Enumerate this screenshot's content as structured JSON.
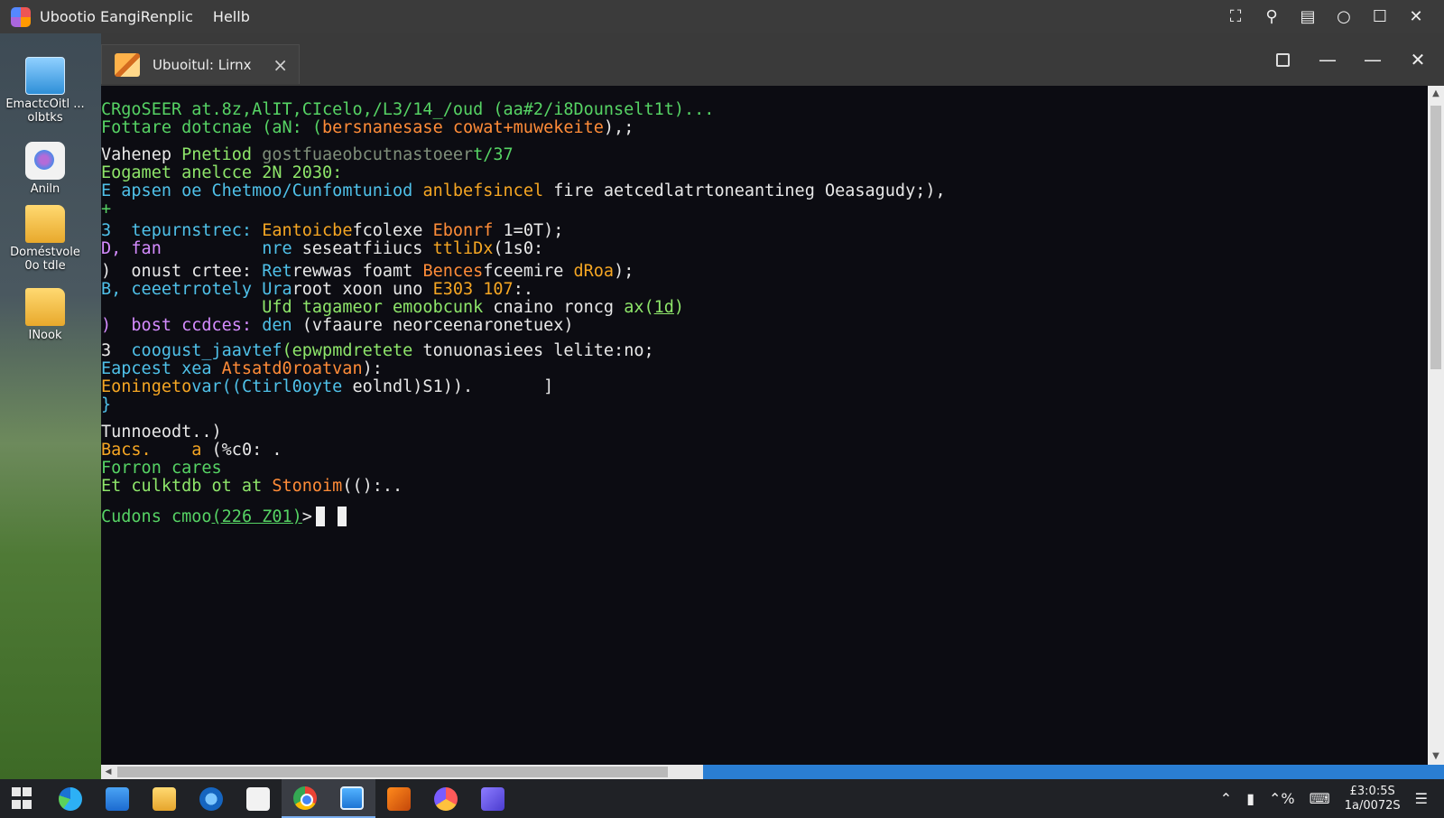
{
  "topbar": {
    "title_1": "Ubootio EangiRenplic",
    "title_2": "Hellb"
  },
  "desktop": {
    "icons": [
      {
        "label": "EmactcOitl ... olbtks",
        "icon": "drive-icon"
      },
      {
        "label": "Aniln",
        "icon": "app-icon"
      },
      {
        "label": "Doméstvole 0o tdle",
        "icon": "folder-icon"
      },
      {
        "label": "INook",
        "icon": "folder-icon"
      }
    ]
  },
  "window": {
    "tab_title": "Ubuoitul: Lirnx",
    "tab_close": "×"
  },
  "terminal": {
    "l1": "CRgoSEER at.8z,AlIT,CIcelo,/L3/14_/oud (aa#2/i8Dounselt1t)...",
    "l2a": "Fottare dotcnae (aN: (",
    "l2b": "bersnanesase cowat+muwekeite",
    "l2c": "),;",
    "l3a": "Vahenep ",
    "l3b": "Pnetiod ",
    "l3c": "gostfuaeobcutnastoeer",
    "l3d": "t/37",
    "l4": "Eogamet anelcce 2N 2030:",
    "l5a": "E apsen oe ",
    "l5b": "Chetmoo/Cunfomtuniod ",
    "l5c": "anlbefsincel ",
    "l5d": "fire aetce",
    "l5e": "dlatrtoneantineg Oeasagudy;),",
    "l6": "+",
    "l7a": "3  tepurnstrec: ",
    "l7b": "Eantoicbe",
    "l7c": "fcolexe ",
    "l7d": "Ebonrf",
    "l7e": " 1=0T);",
    "l8a": "D, fan          ",
    "l8b": "nre ",
    "l8c": "seseatfiiucs ",
    "l8d": "ttliDx",
    "l8e": "(1s0:",
    "l9a": ")  onust crtee: ",
    "l9b": "Ret",
    "l9c": "rewwas foamt ",
    "l9d": "Bences",
    "l9e": "fceemire ",
    "l9f": "dRoa",
    "l9g": ");",
    "l10a": "B, ceeetrrotely ",
    "l10b": "Ura",
    "l10c": "root xoon uno ",
    "l10d": "E303 107",
    "l10e": ":.",
    "l11a": "                ",
    "l11b": "Ufd tagameor emoobcunk ",
    "l11c": "cnaino roncg ",
    "l11d": "ax(",
    "l11e": "1d",
    "l11f": ")",
    "l12a": ")  bost ccdces: ",
    "l12b": "den ",
    "l12c": "(vfaaure neorceenaronetuex)",
    "l13a": "3  ",
    "l13b": "coogust_jaavtef",
    "l13c": "(epwpmdretete ",
    "l13d": "tonuonasiees lelite:no;",
    "l14a": "Eapcest xea ",
    "l14b": "Atsatd0roatvan",
    "l14c": "):",
    "l15a": "Eoningeto",
    "l15b": "var((Ctirl0oyte ",
    "l15c": "eolndl)S1)).       ]",
    "l16": "}",
    "l17": "Tunnoeodt..)",
    "l18a": "Bacs.    a ",
    "l18b": "(%c0: .",
    "l19": "Forron cares",
    "l20a": "Et culktdb ot at ",
    "l20b": "Stonoim",
    "l20c": "(():..",
    "prompt_a": "Cudons cmoo",
    "prompt_b": "(226 Z01)",
    "prompt_c": ">"
  },
  "clock": {
    "time": "£3:0:5S",
    "date": "1a/0072S"
  }
}
